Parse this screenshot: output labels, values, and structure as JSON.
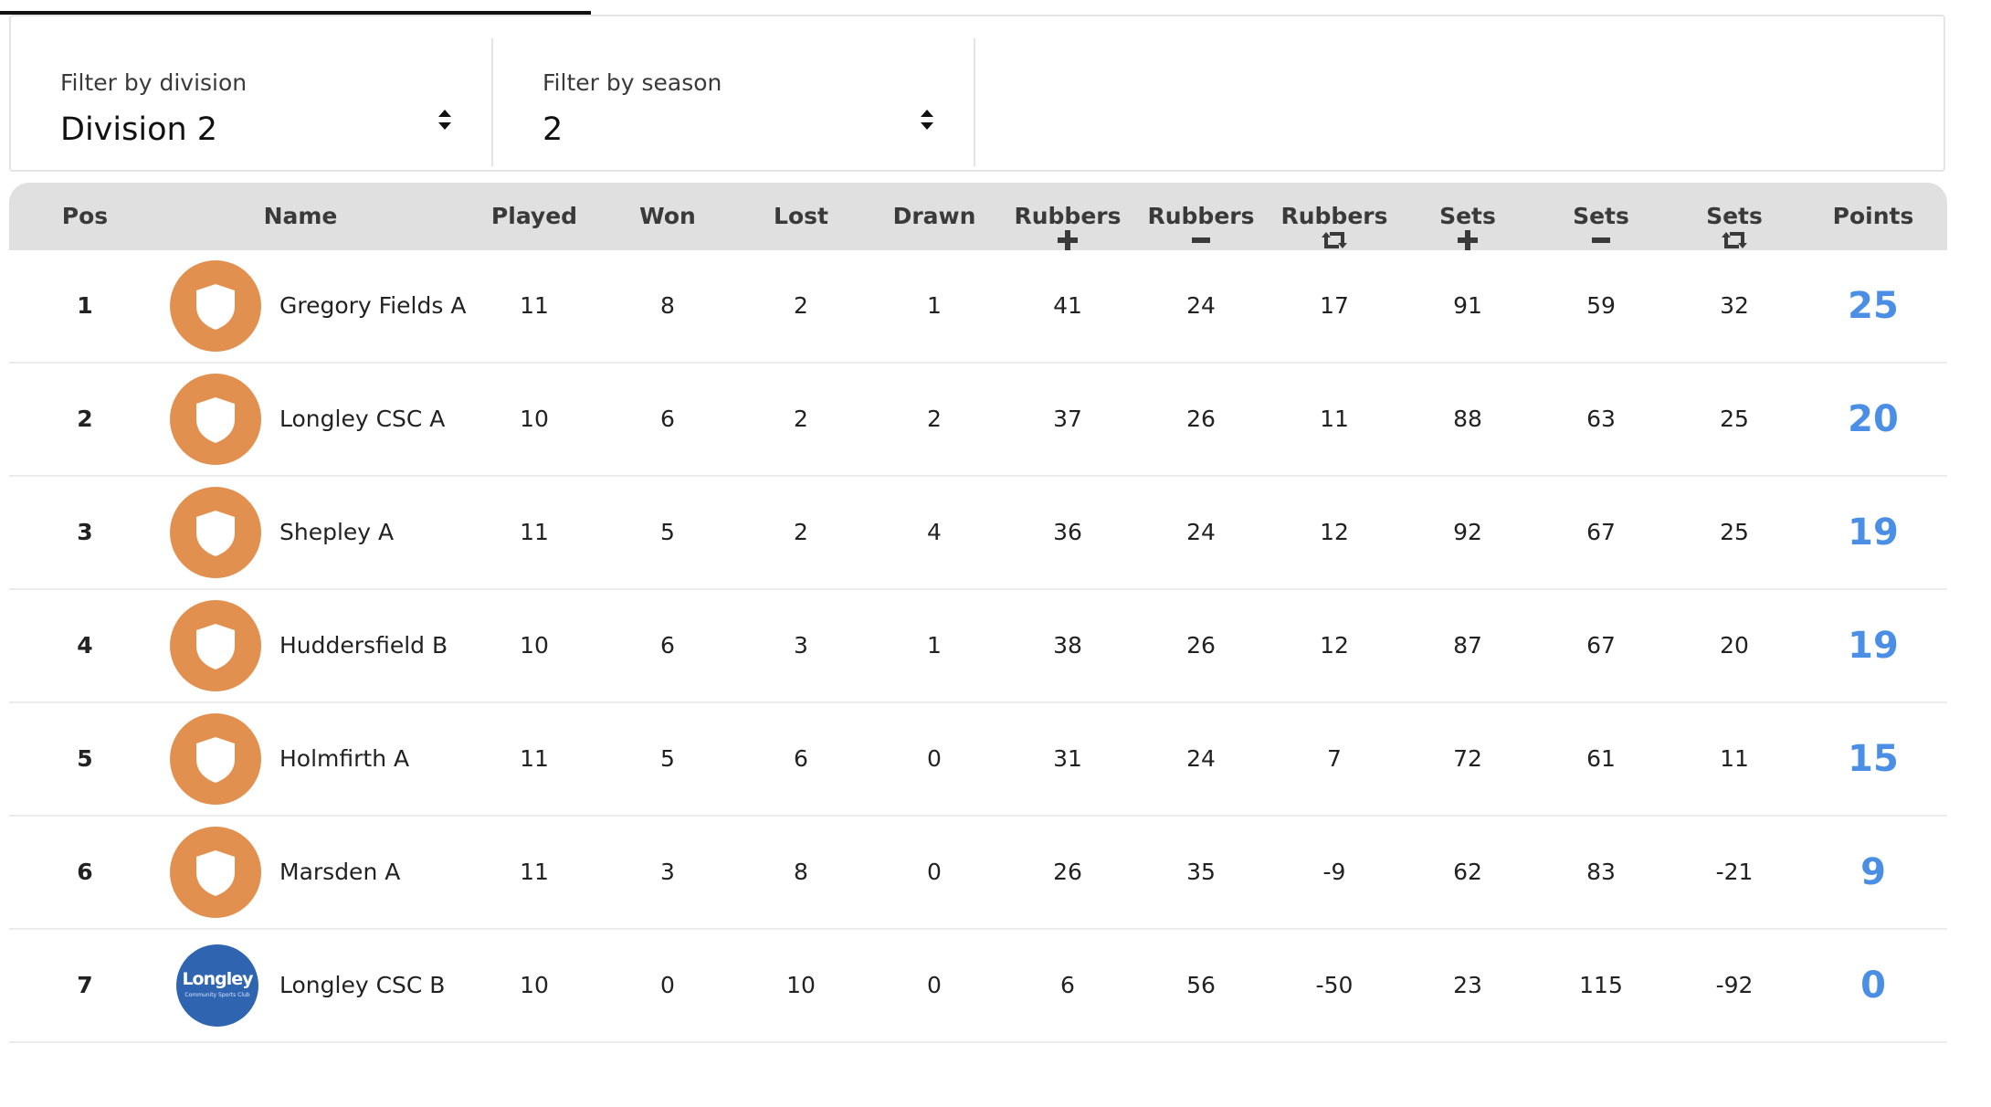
{
  "filters": {
    "division": {
      "label": "Filter by division",
      "value": "Division 2"
    },
    "season": {
      "label": "Filter by season",
      "value": "2"
    }
  },
  "table": {
    "headers": [
      {
        "label": "Pos",
        "icon": ""
      },
      {
        "label": "Name",
        "icon": ""
      },
      {
        "label": "Played",
        "icon": ""
      },
      {
        "label": "Won",
        "icon": ""
      },
      {
        "label": "Lost",
        "icon": ""
      },
      {
        "label": "Drawn",
        "icon": ""
      },
      {
        "label": "Rubbers",
        "icon": "plus-icon"
      },
      {
        "label": "Rubbers",
        "icon": "minus-icon"
      },
      {
        "label": "Rubbers",
        "icon": "retweet-icon"
      },
      {
        "label": "Sets",
        "icon": "plus-icon"
      },
      {
        "label": "Sets",
        "icon": "minus-icon"
      },
      {
        "label": "Sets",
        "icon": "retweet-icon"
      },
      {
        "label": "Points",
        "icon": ""
      }
    ],
    "rows": [
      {
        "pos": "1",
        "name": "Gregory Fields A",
        "logo": "shield-icon",
        "played": "11",
        "won": "8",
        "lost": "2",
        "drawn": "1",
        "rubbers_for": "41",
        "rubbers_against": "24",
        "rubbers_diff": "17",
        "sets_for": "91",
        "sets_against": "59",
        "sets_diff": "32",
        "points": "25"
      },
      {
        "pos": "2",
        "name": "Longley CSC A",
        "logo": "shield-icon",
        "played": "10",
        "won": "6",
        "lost": "2",
        "drawn": "2",
        "rubbers_for": "37",
        "rubbers_against": "26",
        "rubbers_diff": "11",
        "sets_for": "88",
        "sets_against": "63",
        "sets_diff": "25",
        "points": "20"
      },
      {
        "pos": "3",
        "name": "Shepley A",
        "logo": "shield-icon",
        "played": "11",
        "won": "5",
        "lost": "2",
        "drawn": "4",
        "rubbers_for": "36",
        "rubbers_against": "24",
        "rubbers_diff": "12",
        "sets_for": "92",
        "sets_against": "67",
        "sets_diff": "25",
        "points": "19"
      },
      {
        "pos": "4",
        "name": "Huddersfield B",
        "logo": "shield-icon",
        "played": "10",
        "won": "6",
        "lost": "3",
        "drawn": "1",
        "rubbers_for": "38",
        "rubbers_against": "26",
        "rubbers_diff": "12",
        "sets_for": "87",
        "sets_against": "67",
        "sets_diff": "20",
        "points": "19"
      },
      {
        "pos": "5",
        "name": "Holmfirth A",
        "logo": "shield-icon",
        "played": "11",
        "won": "5",
        "lost": "6",
        "drawn": "0",
        "rubbers_for": "31",
        "rubbers_against": "24",
        "rubbers_diff": "7",
        "sets_for": "72",
        "sets_against": "61",
        "sets_diff": "11",
        "points": "15"
      },
      {
        "pos": "6",
        "name": "Marsden A",
        "logo": "shield-icon",
        "played": "11",
        "won": "3",
        "lost": "8",
        "drawn": "0",
        "rubbers_for": "26",
        "rubbers_against": "35",
        "rubbers_diff": "-9",
        "sets_for": "62",
        "sets_against": "83",
        "sets_diff": "-21",
        "points": "9"
      },
      {
        "pos": "7",
        "name": "Longley CSC B",
        "logo": "club-logo",
        "logo_text": "Longley",
        "logo_subtext": "Community Sports Club",
        "played": "10",
        "won": "0",
        "lost": "10",
        "drawn": "0",
        "rubbers_for": "6",
        "rubbers_against": "56",
        "rubbers_diff": "-50",
        "sets_for": "23",
        "sets_against": "115",
        "sets_diff": "-92",
        "points": "0"
      }
    ]
  },
  "colors": {
    "points": "#4a8ee6",
    "logo_shield_bg": "#e2904f",
    "logo_club_bg": "#2f65b0",
    "header_bg": "#e0e0e0"
  }
}
